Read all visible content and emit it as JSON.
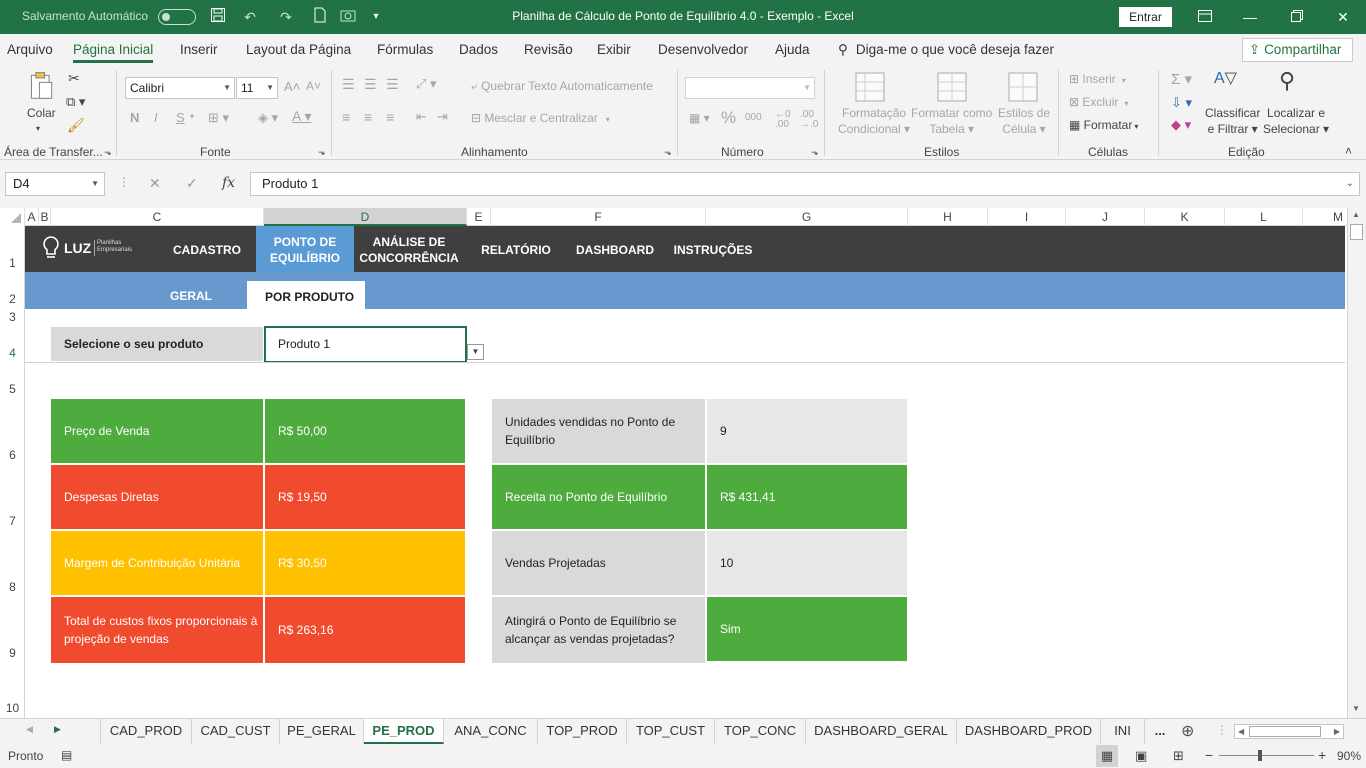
{
  "window": {
    "autosave_label": "Salvamento Automático",
    "title": "Planilha de Cálculo de Ponto de Equilíbrio 4.0 - Exemplo  -  Excel",
    "signin_label": "Entrar"
  },
  "ribbon_tabs": [
    "Arquivo",
    "Página Inicial",
    "Inserir",
    "Layout da Página",
    "Fórmulas",
    "Dados",
    "Revisão",
    "Exibir",
    "Desenvolvedor",
    "Ajuda"
  ],
  "tell_me": "Diga-me o que você deseja fazer",
  "share_label": "Compartilhar",
  "ribbon": {
    "clipboard": {
      "paste": "Colar",
      "group": "Área de Transfer..."
    },
    "font": {
      "name": "Calibri",
      "size": "11",
      "group": "Fonte",
      "bold": "N",
      "italic": "I",
      "underline": "S"
    },
    "alignment": {
      "wrap": "Quebrar Texto Automaticamente",
      "merge": "Mesclar e Centralizar",
      "group": "Alinhamento"
    },
    "number": {
      "group": "Número",
      "percent": "%",
      "thousands": "000"
    },
    "styles": {
      "conditional_1": "Formatação",
      "conditional_2": "Condicional",
      "table_1": "Formatar como",
      "table_2": "Tabela",
      "cell_1": "Estilos de",
      "cell_2": "Célula",
      "group": "Estilos"
    },
    "cells": {
      "insert": "Inserir",
      "delete": "Excluir",
      "format": "Formatar",
      "group": "Células"
    },
    "editing": {
      "sort_1": "Classificar",
      "sort_2": "e Filtrar",
      "find_1": "Localizar e",
      "find_2": "Selecionar",
      "group": "Edição"
    }
  },
  "formula_bar": {
    "name_box": "D4",
    "fx": "fx",
    "content": "Produto 1"
  },
  "columns": [
    "A",
    "B",
    "C",
    "D",
    "E",
    "F",
    "G",
    "H",
    "I",
    "J",
    "K",
    "L",
    "M"
  ],
  "rows": [
    "1",
    "2",
    "3",
    "4",
    "5",
    "6",
    "7",
    "8",
    "9",
    "10"
  ],
  "app_nav": {
    "logo_text": "LUZ",
    "logo_sub_1": "Planilhas",
    "logo_sub_2": "Empresariais",
    "items": [
      {
        "line1": "CADASTRO",
        "line2": ""
      },
      {
        "line1": "PONTO DE",
        "line2": "EQUILÍBRIO"
      },
      {
        "line1": "ANÁLISE DE",
        "line2": "CONCORRÊNCIA"
      },
      {
        "line1": "RELATÓRIO",
        "line2": ""
      },
      {
        "line1": "DASHBOARD",
        "line2": ""
      },
      {
        "line1": "INSTRUÇÕES",
        "line2": ""
      }
    ],
    "sub_items": [
      "GERAL",
      "POR PRODUTO"
    ]
  },
  "product_select": {
    "label": "Selecione o seu produto",
    "value": "Produto 1"
  },
  "left_cards": [
    {
      "label": "Preço de Venda",
      "value": "R$ 50,00",
      "color": "#4eac3e"
    },
    {
      "label": "Despesas Diretas",
      "value": "R$ 19,50",
      "color": "#f04b2f"
    },
    {
      "label": "Margem de Contribuição Unitária",
      "value": "R$ 30,50",
      "color": "#ffc000"
    },
    {
      "label": "Total de custos fixos proporcionais à projeção de vendas",
      "value": "R$ 263,16",
      "color": "#f04b2f"
    }
  ],
  "right_cards": [
    {
      "label": "Unidades vendidas no Ponto de Equilíbrio",
      "value": "9",
      "label_color": "#d9d9d9",
      "value_color": "#e7e7e7"
    },
    {
      "label": "Receita no Ponto de Equilíbrio",
      "value": "R$ 431,41",
      "label_color": "#4eac3e",
      "value_color": "#4eac3e"
    },
    {
      "label": "Vendas Projetadas",
      "value": "10",
      "label_color": "#d9d9d9",
      "value_color": "#e7e7e7"
    },
    {
      "label": "Atingirá o Ponto de Equilíbrio se alcançar as vendas projetadas?",
      "value": "Sim",
      "label_color": "#d9d9d9",
      "value_color": "#4eac3e"
    }
  ],
  "sheet_tabs": [
    "CAD_PROD",
    "CAD_CUST",
    "PE_GERAL",
    "PE_PROD",
    "ANA_CONC",
    "TOP_PROD",
    "TOP_CUST",
    "TOP_CONC",
    "DASHBOARD_GERAL",
    "DASHBOARD_PROD",
    "INI",
    "..."
  ],
  "active_sheet": "PE_PROD",
  "status": {
    "ready": "Pronto",
    "zoom": "90%"
  }
}
